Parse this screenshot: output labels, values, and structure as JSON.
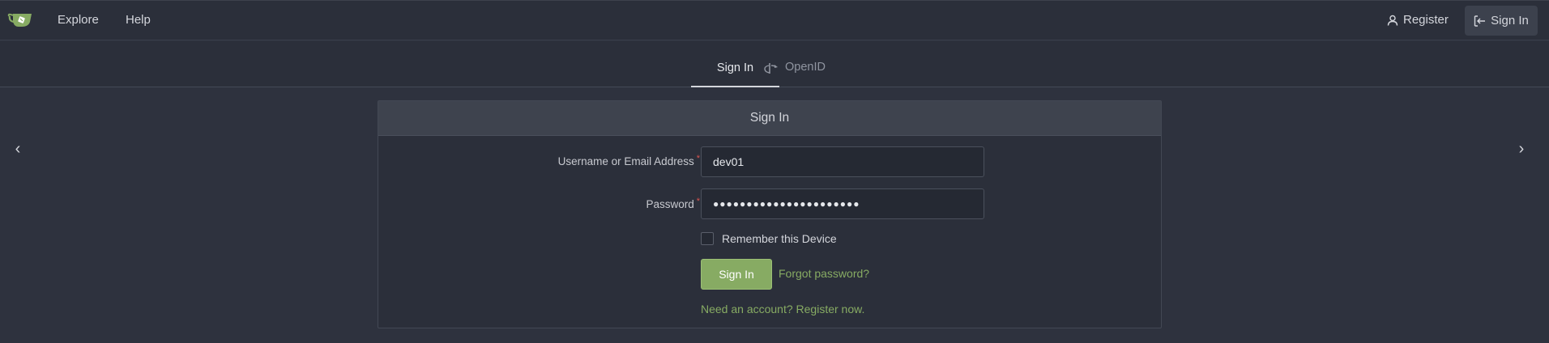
{
  "nav": {
    "explore": "Explore",
    "help": "Help",
    "register": "Register",
    "sign_in": "Sign In",
    "logo_icon": "gitea-teacup-icon",
    "register_icon": "person-icon",
    "sign_in_icon": "sign-in-icon"
  },
  "tabs": {
    "sign_in": "Sign In",
    "openid": "OpenID",
    "openid_icon": "openid-icon"
  },
  "carousel": {
    "prev": "‹",
    "next": "›"
  },
  "form": {
    "header": "Sign In",
    "username_label": "Username or Email Address",
    "username_value": "dev01",
    "password_label": "Password",
    "password_value": "●●●●●●●●●●●●●●●●●●●●●●",
    "required_mark": "*",
    "remember_label": "Remember this Device",
    "remember_checked": false,
    "submit_label": "Sign In",
    "forgot_label": "Forgot password?",
    "register_link": "Need an account? Register now."
  },
  "colors": {
    "accent": "#87ab63",
    "background": "#2e323e",
    "navbar": "#2b2f3a",
    "required": "#d9534f"
  }
}
